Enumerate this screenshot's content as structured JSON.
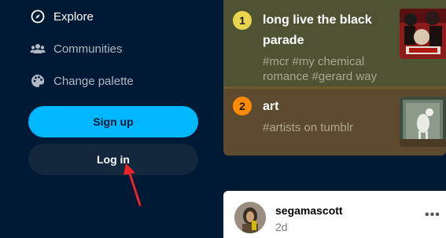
{
  "sidebar": {
    "items": [
      {
        "label": "Explore",
        "icon": "compass-icon"
      },
      {
        "label": "Communities",
        "icon": "people-icon"
      },
      {
        "label": "Change palette",
        "icon": "palette-icon"
      }
    ],
    "signup_label": "Sign up",
    "login_label": "Log in"
  },
  "trending": [
    {
      "rank": "1",
      "title": "long live the black parade",
      "tags": "#mcr #my chemical romance #gerard way"
    },
    {
      "rank": "2",
      "title": "art",
      "tags": "#artists on tumblr"
    }
  ],
  "post": {
    "username": "segamascott",
    "time": "2d",
    "more_label": "•••"
  },
  "colors": {
    "background": "#001935",
    "accent": "#00b8ff",
    "rank1": "#e8d44d",
    "rank2": "#ff8a00",
    "annotation_arrow": "#e8232a"
  }
}
